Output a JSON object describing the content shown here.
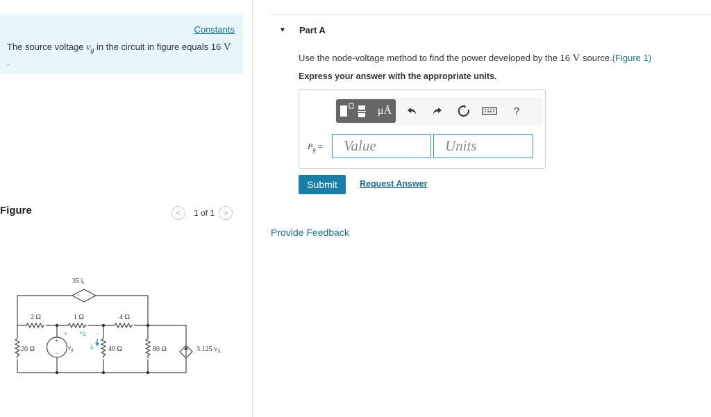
{
  "left_panel": {
    "constants_link": "Constants",
    "problem": {
      "prefix": "The source voltage ",
      "symbol": "v",
      "symbol_sub": "g",
      "middle": " in the circuit in figure equals 16 ",
      "unit": "V",
      "trailing": "."
    },
    "figure": {
      "title": "Figure",
      "page_indicator": "1 of 1",
      "prev": "<",
      "next": ">"
    },
    "circuit_labels": {
      "dep_source": "35 i",
      "dep_source_sub": "t",
      "r1": "2 Ω",
      "r2": "1 Ω",
      "r3": "4 Ω",
      "r4": "20 Ω",
      "r5": "40 Ω",
      "r6": "80 Ω",
      "vdelta": "v",
      "vdelta_sub": "Δ",
      "vg": "v",
      "vg_sub": "g",
      "it": "i",
      "it_sub": "t",
      "current_source": "3.125 v",
      "current_source_sub": "Δ",
      "plus": "+",
      "minus": "−"
    }
  },
  "right_panel": {
    "part_toggle": "▼",
    "part_title": "Part A",
    "question": {
      "prefix": "Use the node-voltage method to find the power developed by the 16 ",
      "unit": "V",
      "middle": " source.",
      "figure_link": "(Figure 1)"
    },
    "express": "Express your answer with the appropriate units.",
    "toolbar": {
      "units_button": "μÅ",
      "help": "?"
    },
    "variable": {
      "symbol": "P",
      "sub": "g",
      "equals": " ="
    },
    "value_placeholder": "Value",
    "units_placeholder": "Units",
    "submit": "Submit",
    "request_answer": "Request Answer",
    "provide_feedback": "Provide Feedback"
  }
}
